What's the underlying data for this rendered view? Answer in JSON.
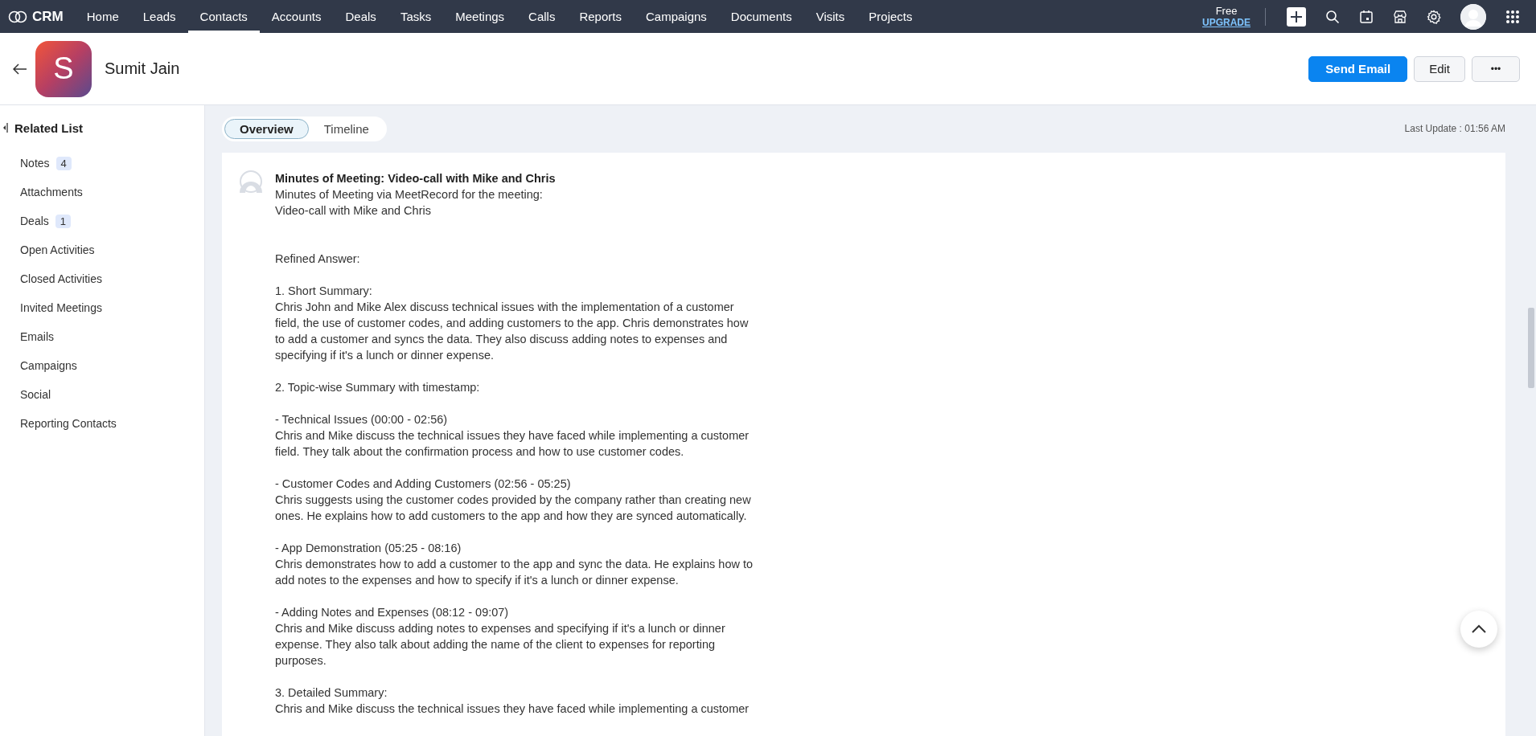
{
  "topbar": {
    "logo": "CRM",
    "nav": [
      {
        "label": "Home",
        "selected": false
      },
      {
        "label": "Leads",
        "selected": false
      },
      {
        "label": "Contacts",
        "selected": true
      },
      {
        "label": "Accounts",
        "selected": false
      },
      {
        "label": "Deals",
        "selected": false
      },
      {
        "label": "Tasks",
        "selected": false
      },
      {
        "label": "Meetings",
        "selected": false
      },
      {
        "label": "Calls",
        "selected": false
      },
      {
        "label": "Reports",
        "selected": false
      },
      {
        "label": "Campaigns",
        "selected": false
      },
      {
        "label": "Documents",
        "selected": false
      },
      {
        "label": "Visits",
        "selected": false
      },
      {
        "label": "Projects",
        "selected": false
      }
    ],
    "plan": "Free",
    "upgrade": "UPGRADE"
  },
  "header": {
    "initial": "S",
    "name": "Sumit Jain",
    "buttons": [
      {
        "label": "Send Email",
        "kind": "primary"
      },
      {
        "label": "Edit",
        "kind": "secondary"
      },
      {
        "label": "•••",
        "kind": "more"
      }
    ]
  },
  "sidebar": {
    "title": "Related List",
    "items": [
      {
        "label": "Notes",
        "count": "4"
      },
      {
        "label": "Attachments"
      },
      {
        "label": "Deals",
        "count": "1"
      },
      {
        "label": "Open Activities"
      },
      {
        "label": "Closed Activities"
      },
      {
        "label": "Invited Meetings"
      },
      {
        "label": "Emails"
      },
      {
        "label": "Campaigns"
      },
      {
        "label": "Social"
      },
      {
        "label": "Reporting Contacts"
      }
    ]
  },
  "tabs": [
    {
      "label": "Overview",
      "selected": true
    },
    {
      "label": "Timeline",
      "selected": false
    }
  ],
  "last_update": "Last Update : 01:56 AM",
  "note": {
    "title": "Minutes of Meeting: Video-call with Mike and Chris",
    "paragraphs": [
      "Minutes of Meeting via MeetRecord for the meeting:\nVideo-call with Mike and Chris",
      "Refined Answer:",
      "1. Short Summary:\nChris John and Mike Alex discuss technical issues with the implementation of a customer field, the use of customer codes, and adding customers to the app. Chris demonstrates how to add a customer and syncs the data. They also discuss adding notes to expenses and specifying if it's a lunch or dinner expense.",
      "2. Topic-wise Summary with timestamp:",
      "- Technical Issues (00:00 - 02:56)\nChris and Mike discuss the technical issues they have faced while implementing a customer field. They talk about the confirmation process and how to use customer codes.",
      "- Customer Codes and Adding Customers (02:56 - 05:25)\nChris suggests using the customer codes provided by the company rather than creating new ones. He explains how to add customers to the app and how they are synced automatically.",
      "- App Demonstration (05:25 - 08:16)\nChris demonstrates how to add a customer to the app and sync the data. He explains how to add notes to the expenses and how to specify if it's a lunch or dinner expense.",
      "- Adding Notes and Expenses (08:12 - 09:07)\nChris and Mike discuss adding notes to expenses and specifying if it's a lunch or dinner expense. They also talk about adding the name of the client to expenses for reporting purposes.",
      "3. Detailed Summary:\nChris and Mike discuss the technical issues they have faced while implementing a customer"
    ]
  }
}
